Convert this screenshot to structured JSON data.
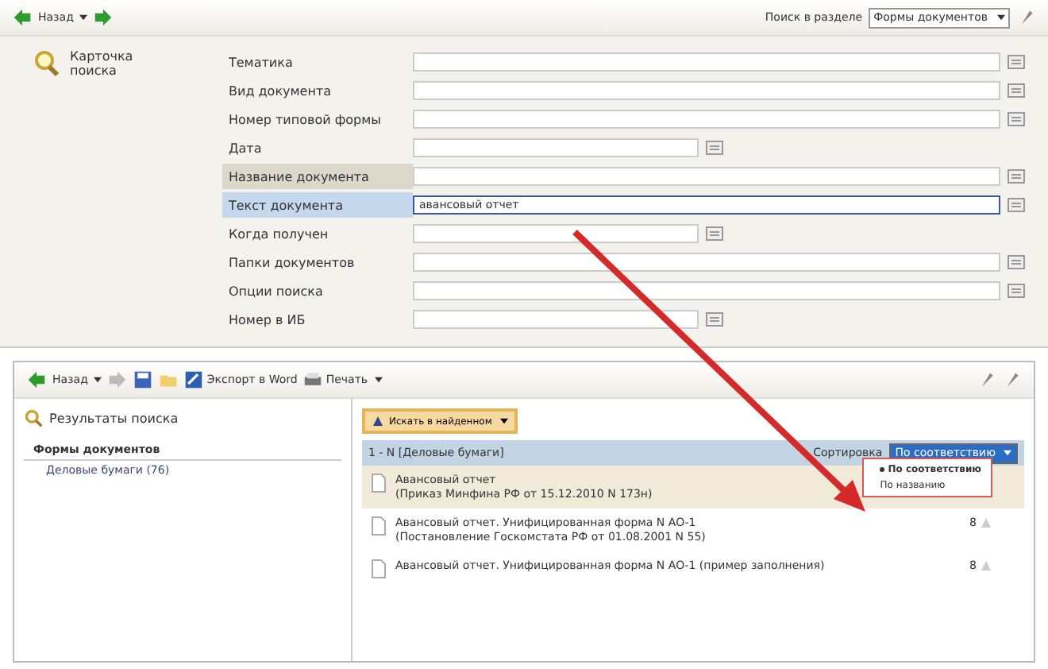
{
  "top_toolbar": {
    "back_label": "Назад",
    "section_label": "Поиск в разделе",
    "section_value": "Формы документов"
  },
  "search_card": {
    "title": "Карточка поиска",
    "fields": [
      {
        "label": "Тематика",
        "kind": "wide",
        "hovered": false,
        "focused": false
      },
      {
        "label": "Вид документа",
        "kind": "wide",
        "hovered": false,
        "focused": false
      },
      {
        "label": "Номер типовой формы",
        "kind": "wide",
        "hovered": false,
        "focused": false
      },
      {
        "label": "Дата",
        "kind": "short",
        "hovered": false,
        "focused": false
      },
      {
        "label": "Название документа",
        "kind": "wide",
        "hovered": true,
        "focused": false
      },
      {
        "label": "Текст документа",
        "kind": "wide",
        "value": "авансовый отчет",
        "hovered": false,
        "focused": true
      },
      {
        "label": "Когда получен",
        "kind": "short",
        "hovered": false,
        "focused": false
      },
      {
        "label": "Папки документов",
        "kind": "wide",
        "hovered": false,
        "focused": false
      },
      {
        "label": "Опции поиска",
        "kind": "wide",
        "hovered": false,
        "focused": false
      },
      {
        "label": "Номер в ИБ",
        "kind": "short",
        "hovered": false,
        "focused": false
      }
    ]
  },
  "results_toolbar": {
    "back_label": "Назад",
    "export_label": "Экспорт в Word",
    "print_label": "Печать"
  },
  "results_tree": {
    "title": "Результаты поиска",
    "group": "Формы документов",
    "items": [
      {
        "label": "Деловые бумаги (76)",
        "selected": false
      }
    ]
  },
  "results_list": {
    "search_in_found": "Искать в найденном",
    "header": "1 - N [Деловые бумаги]",
    "sort_label": "Сортировка",
    "sort_value": "По соответствию",
    "sort_options": [
      {
        "label": "По соответствию",
        "selected": true
      },
      {
        "label": "По названию",
        "selected": false
      }
    ],
    "rows": [
      {
        "title": "Авансовый отчет",
        "subtitle": "(Приказ Минфина РФ от 15.12.2010 N 173н)",
        "selected": true
      },
      {
        "title": "Авансовый отчет. Унифицированная форма N АО-1",
        "subtitle": "(Постановление Госкомстата РФ от 01.08.2001 N 55)",
        "count": "8",
        "selected": false
      },
      {
        "title": "Авансовый отчет. Унифицированная форма N АО-1 (пример заполнения)",
        "count": "8",
        "selected": false
      }
    ]
  }
}
